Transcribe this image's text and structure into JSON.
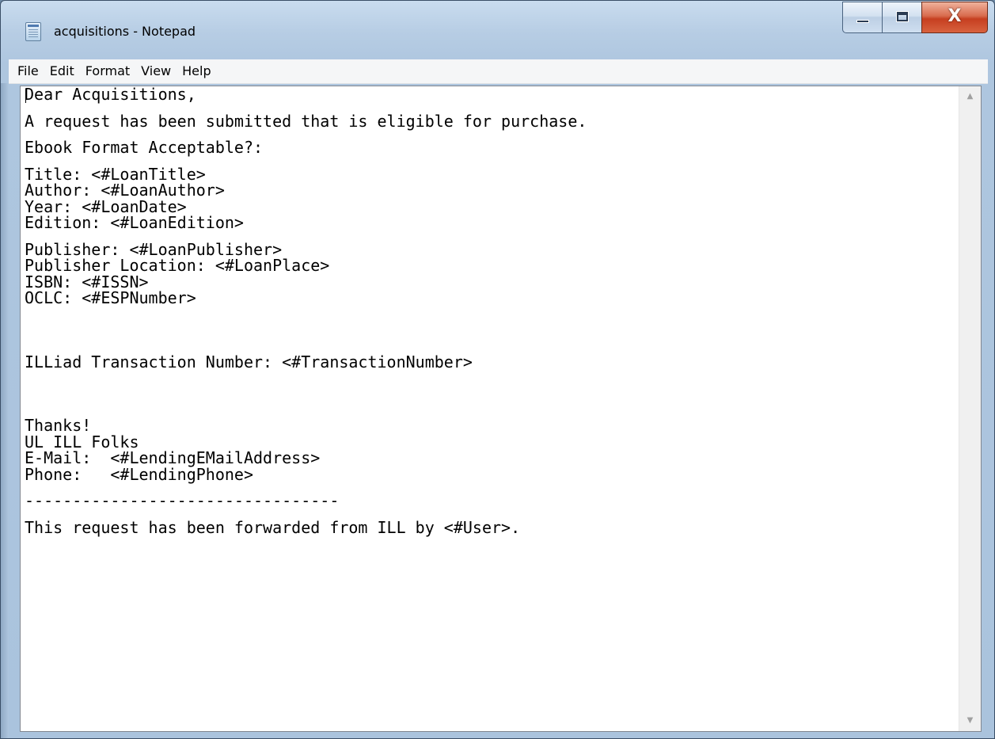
{
  "window": {
    "title": "acquisitions - Notepad",
    "icons": {
      "app": "notepad-icon",
      "minimize": "minimize-icon",
      "maximize": "maximize-icon",
      "close": "close-icon",
      "close_glyph": "X"
    }
  },
  "menu": {
    "items": [
      "File",
      "Edit",
      "Format",
      "View",
      "Help"
    ]
  },
  "document": {
    "lines": [
      "Dear Acquisitions,",
      "",
      "A request has been submitted that is eligible for purchase.",
      "",
      "Ebook Format Acceptable?:",
      "",
      "Title: <#LoanTitle>",
      "Author: <#LoanAuthor>",
      "Year: <#LoanDate>",
      "Edition: <#LoanEdition>",
      "",
      "Publisher: <#LoanPublisher>",
      "Publisher Location: <#LoanPlace>",
      "ISBN: <#ISSN>",
      "OCLC: <#ESPNumber>",
      "",
      "",
      "ILLiad Transaction Number: <#TransactionNumber>",
      "",
      "",
      "Thanks!",
      "UL ILL Folks",
      "E-Mail:  <#LendingEMailAddress>",
      "Phone:   <#LendingPhone>",
      "",
      "---------------------------------",
      "",
      "This request has been forwarded from ILL by <#User>."
    ]
  },
  "scrollbar": {
    "up_glyph": "▲",
    "down_glyph": "▼"
  },
  "colors": {
    "title_bar": "#b7cde4",
    "close_button": "#c63f20",
    "menu_bar": "#f5f6f7",
    "editor_bg": "#ffffff"
  }
}
